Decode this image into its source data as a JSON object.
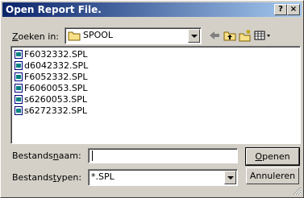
{
  "window": {
    "title": "Open Report File.",
    "help_label": "?",
    "close_label": "×"
  },
  "look_in": {
    "label_pre": "Z",
    "label_post": "oeken in:",
    "value": "SPOOL"
  },
  "toolbar": {
    "icons": [
      "back-arrow-icon",
      "up-folder-icon",
      "new-folder-icon",
      "view-menu-icon"
    ]
  },
  "files": [
    {
      "name": "F6032332.SPL"
    },
    {
      "name": "d6042332.SPL"
    },
    {
      "name": "F6052332.SPL"
    },
    {
      "name": "F6060053.SPL"
    },
    {
      "name": "s6260053.SPL"
    },
    {
      "name": "s6272332.SPL"
    }
  ],
  "filename": {
    "label_pre": "Bestands",
    "label_u": "n",
    "label_post": "aam:",
    "value": ""
  },
  "filetype": {
    "label_pre": "Bestands",
    "label_u": "t",
    "label_post": "ypen:",
    "value": "*.SPL"
  },
  "buttons": {
    "open_u": "O",
    "open_rest": "penen",
    "cancel": "Annuleren"
  },
  "colors": {
    "title_start": "#0a246a",
    "title_end": "#a6caf0",
    "face": "#d4d0c8"
  }
}
